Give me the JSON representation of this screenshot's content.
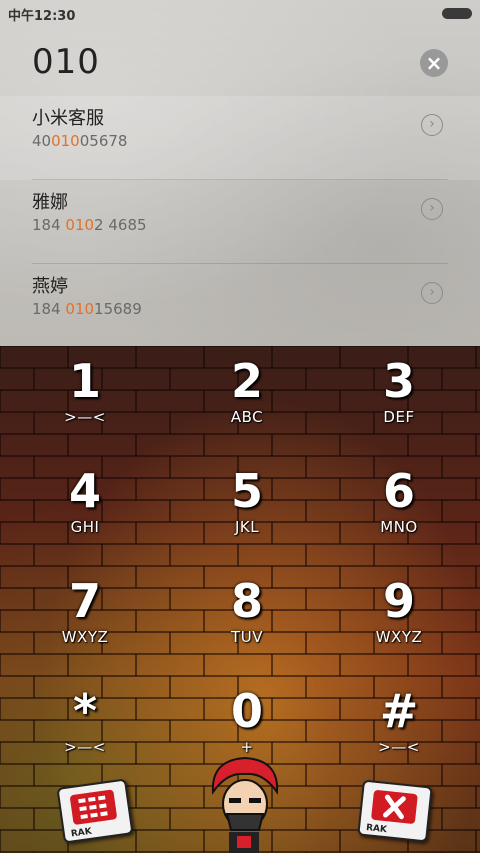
{
  "status_bar": {
    "time": "中午12:30"
  },
  "dialer": {
    "input": "010",
    "clear_icon": "close-icon"
  },
  "results": [
    {
      "name": "小米客服",
      "number_parts": [
        "40",
        "010",
        "05678"
      ]
    },
    {
      "name": "雅娜",
      "number_parts": [
        "184 ",
        "010",
        "2 4685"
      ]
    },
    {
      "name": "燕婷",
      "number_parts": [
        "184 ",
        "010",
        "15689"
      ]
    }
  ],
  "keypad": [
    {
      "digit": "1",
      "letters": ">—<"
    },
    {
      "digit": "2",
      "letters": "ABC"
    },
    {
      "digit": "3",
      "letters": "DEF"
    },
    {
      "digit": "4",
      "letters": "GHI"
    },
    {
      "digit": "5",
      "letters": "JKL"
    },
    {
      "digit": "6",
      "letters": "MNO"
    },
    {
      "digit": "7",
      "letters": "WXYZ"
    },
    {
      "digit": "8",
      "letters": "TUV"
    },
    {
      "digit": "9",
      "letters": "WXYZ"
    },
    {
      "digit": "*",
      "letters": ">—<"
    },
    {
      "digit": "0",
      "letters": "+"
    },
    {
      "digit": "#",
      "letters": ">—<"
    }
  ],
  "bottom_bar": {
    "left_sticker_text": "RAK",
    "right_sticker_text": "RAK"
  },
  "colors": {
    "highlight": "#e2712a",
    "sticker_red": "#d11a22"
  }
}
